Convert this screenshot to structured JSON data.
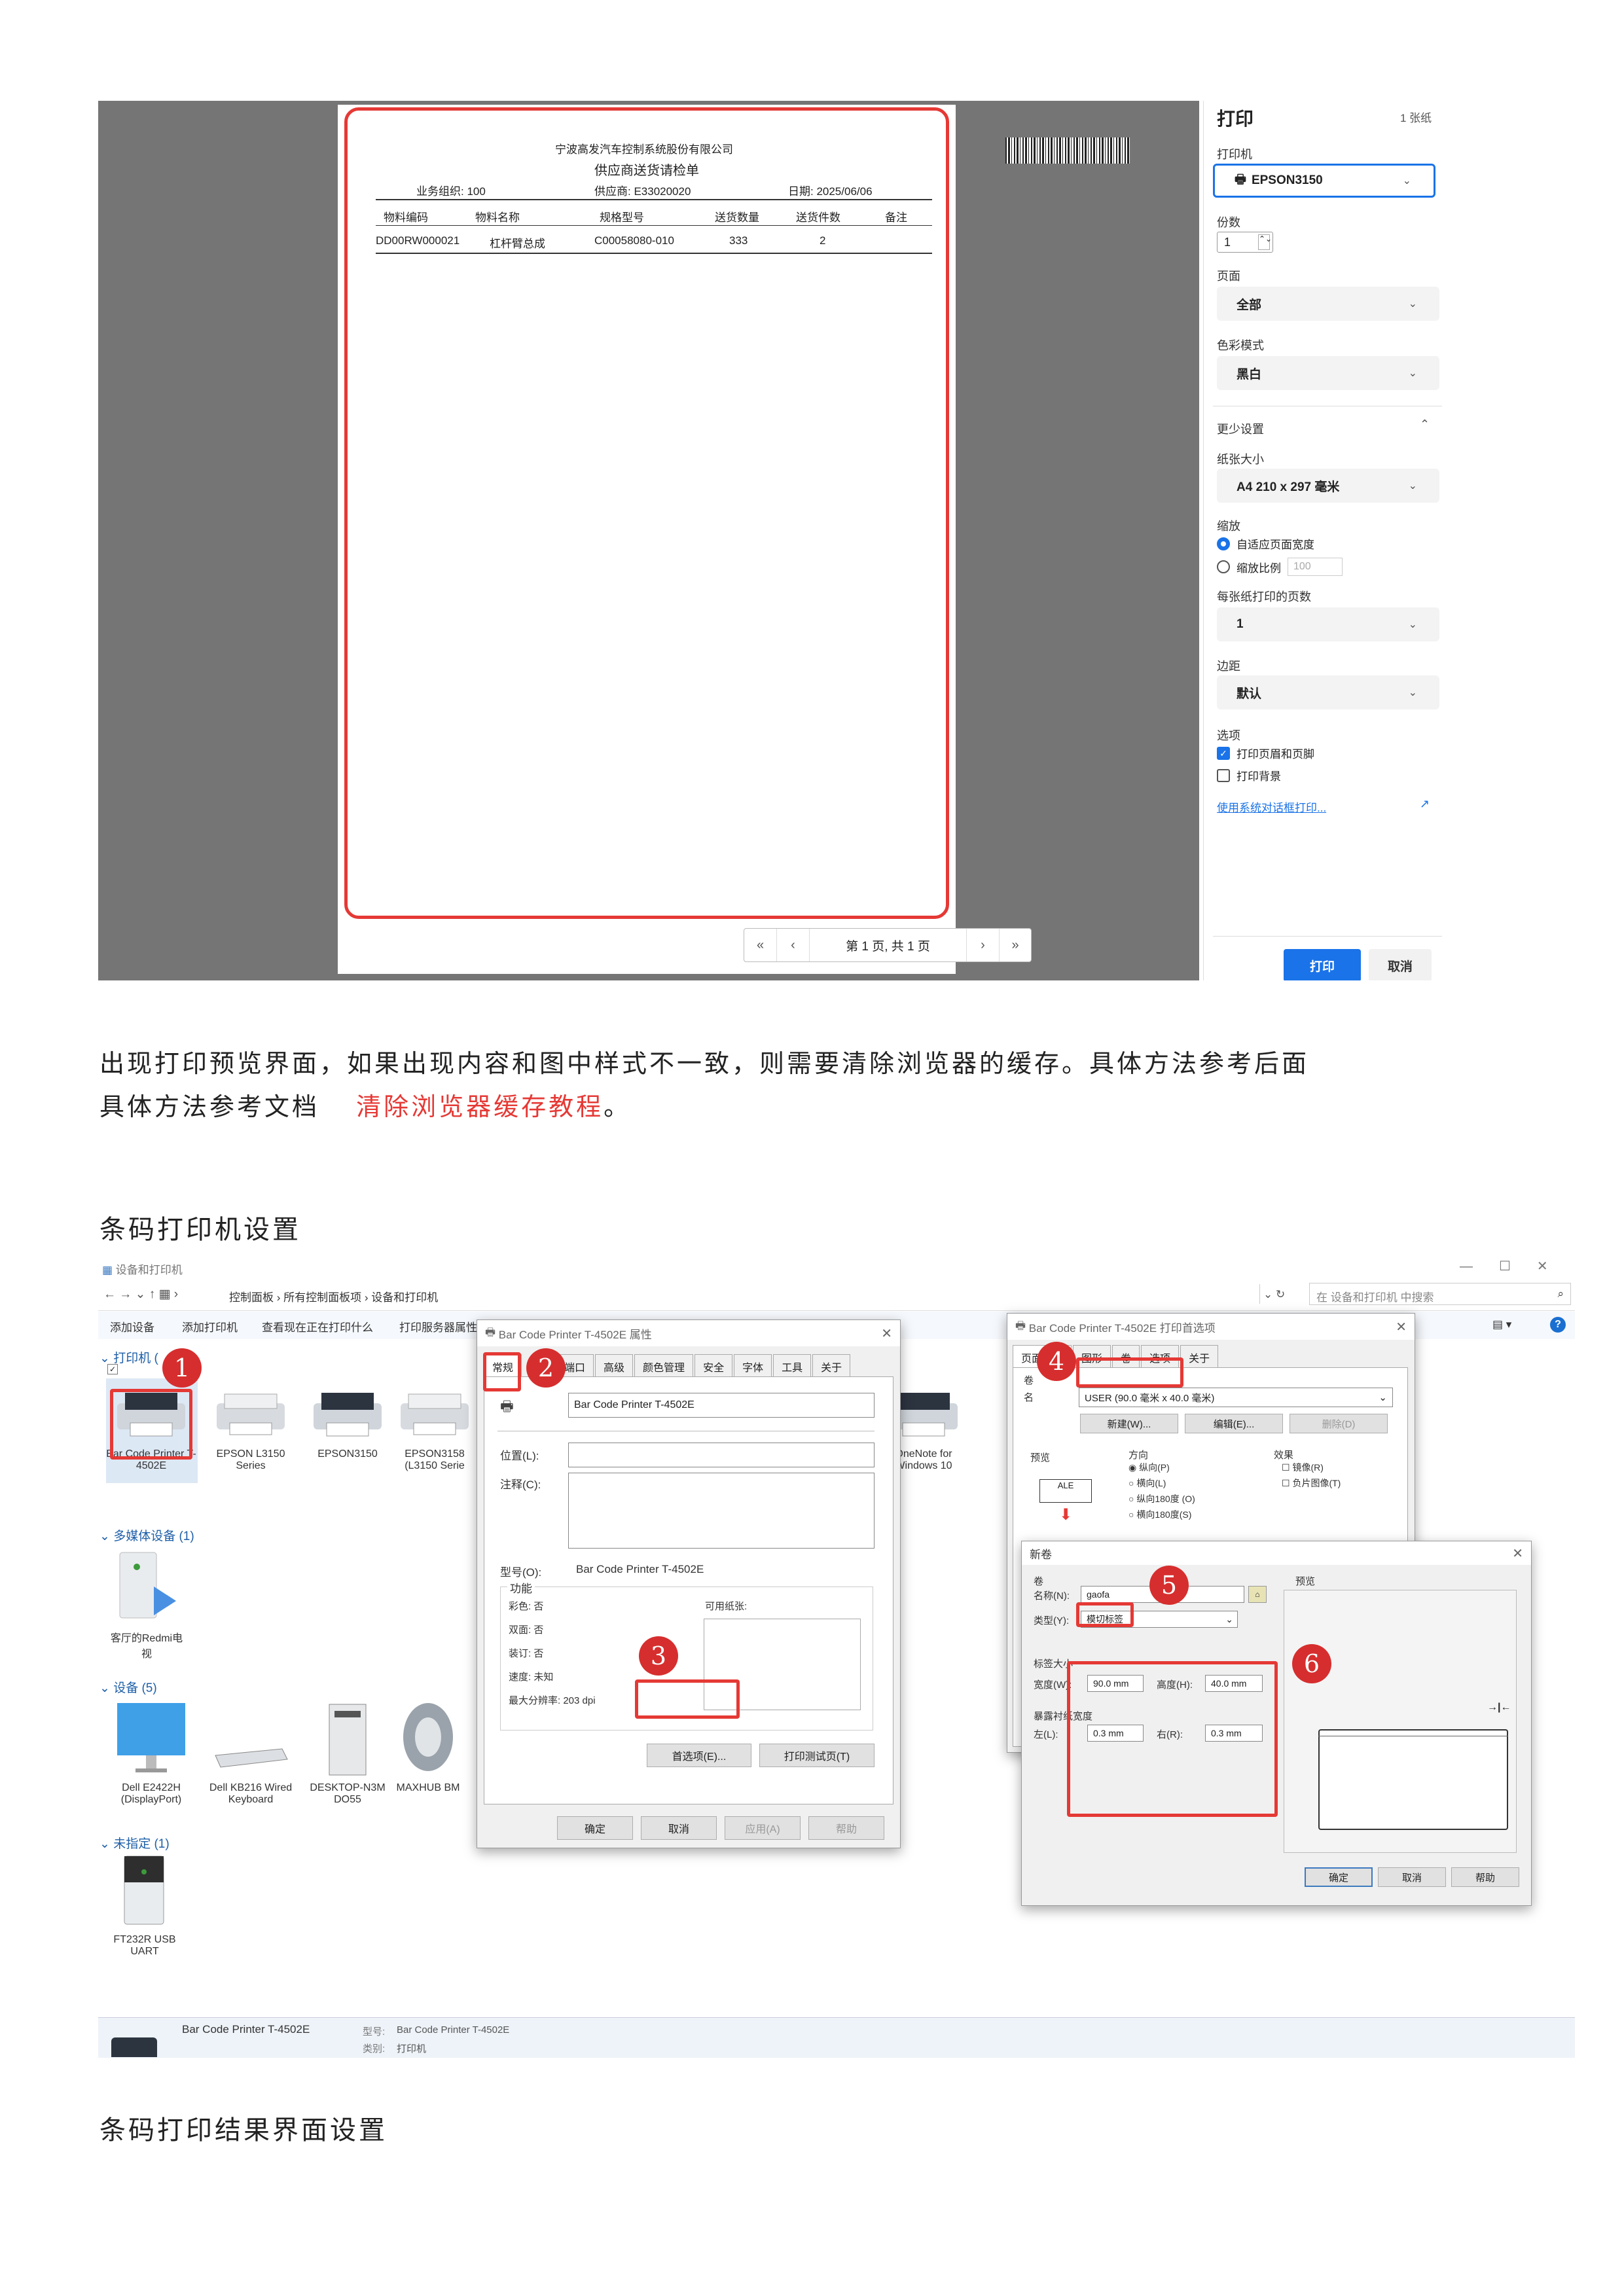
{
  "print_preview": {
    "company": "宁波高发汽车控制系统股份有限公司",
    "doc_title": "供应商送货请检单",
    "org_label": "业务组织: 100",
    "supplier_label": "供应商: E33020020",
    "date_label": "日期: 2025/06/06",
    "columns": [
      "物料编码",
      "物料名称",
      "规格型号",
      "送货数量",
      "送货件数",
      "备注"
    ],
    "row": [
      "DD00RW000021",
      "杠杆臂总成",
      "C00058080-010",
      "333",
      "2",
      ""
    ],
    "pager": {
      "first": "«",
      "prev": "‹",
      "page_text": "第 1 页, 共 1 页",
      "next": "›",
      "last": "»"
    }
  },
  "print_panel": {
    "title": "打印",
    "sheets": "1 张纸",
    "printer_label": "打印机",
    "printer_value": "EPSON3150",
    "copies_label": "份数",
    "copies_value": "1",
    "pages_label": "页面",
    "pages_value": "全部",
    "color_label": "色彩模式",
    "color_value": "黑白",
    "less_settings": "更少设置",
    "paper_label": "纸张大小",
    "paper_value": "A4 210 x 297 毫米",
    "scale_label": "缩放",
    "scale_fit": "自适应页面宽度",
    "scale_ratio": "缩放比例",
    "scale_ratio_value": "100",
    "pages_per_sheet_label": "每张纸打印的页数",
    "pages_per_sheet_value": "1",
    "margins_label": "边距",
    "margins_value": "默认",
    "options_label": "选项",
    "opt_header_footer": "打印页眉和页脚",
    "opt_background": "打印背景",
    "system_dialog_link": "使用系统对话框打印...",
    "print_button": "打印",
    "cancel_button": "取消"
  },
  "doc": {
    "line1": "出现打印预览界面，如果出现内容和图中样式不一致，则需要清除浏览器的缓存。具体方法参考后面",
    "line2_prefix": "具体方法参考文档",
    "line2_link": "清除浏览器缓存教程",
    "line2_suffix": "。",
    "heading1": "条码打印机设置",
    "heading2": "条码打印结果界面设置"
  },
  "devices_window": {
    "title": "设备和打印机",
    "breadcrumb": [
      "控制面板",
      "所有控制面板项",
      "设备和打印机"
    ],
    "search_placeholder": "在 设备和打印机 中搜索",
    "toolbar": [
      "添加设备",
      "添加打印机",
      "查看现在正在打印什么",
      "打印服务器属性"
    ],
    "group_printers": "打印机 (",
    "group_media": "多媒体设备 (1)",
    "group_devices": "设备 (5)",
    "group_unspecified": "未指定 (1)",
    "printers": [
      "Bar Code Printer T-4502E",
      "EPSON L3150 Series",
      "EPSON3150",
      "EPSON3158 (L3150 Serie",
      "OneNote for Windows 10"
    ],
    "media": [
      "客厅的Redmi电视"
    ],
    "devices": [
      "Dell E2422H (DisplayPort)",
      "Dell KB216 Wired Keyboard",
      "DESKTOP-N3M DO55",
      "MAXHUB BM"
    ],
    "unspecified": [
      "FT232R USB UART"
    ],
    "status_name": "Bar Code Printer T-4502E",
    "status_model_label": "型号:",
    "status_model": "Bar Code Printer T-4502E",
    "status_cat_label": "类别:",
    "status_cat": "打印机"
  },
  "props_dialog": {
    "title": "Bar Code Printer T-4502E 属性",
    "tabs": [
      "常规",
      "端口",
      "高级",
      "颜色管理",
      "安全",
      "字体",
      "工具",
      "关于"
    ],
    "name_value": "Bar Code Printer T-4502E",
    "location_label": "位置(L):",
    "comment_label": "注释(C):",
    "model_label": "型号(O):",
    "model_value": "Bar Code Printer T-4502E",
    "features_label": "功能",
    "color": "彩色: 否",
    "duplex": "双面: 否",
    "staple": "装订: 否",
    "speed": "速度: 未知",
    "dpi": "最大分辨率: 203 dpi",
    "paper_avail": "可用纸张:",
    "pref_button": "首选项(E)...",
    "test_button": "打印测试页(T)",
    "ok": "确定",
    "cancel": "取消",
    "apply": "应用(A)",
    "help": "帮助"
  },
  "prefs_dialog": {
    "title": "Bar Code Printer T-4502E 打印首选项",
    "tabs": [
      "页面设置",
      "图形",
      "卷",
      "选项",
      "关于"
    ],
    "stock_label": "卷",
    "name_prefix": "名",
    "stock_value": "USER (90.0 毫米 x 40.0 毫米)",
    "new_button": "新建(W)...",
    "edit_button": "编辑(E)...",
    "delete_button": "删除(D)",
    "preview_label": "预览",
    "preview_sample": "ALE",
    "orient_label": "方向",
    "orient": [
      "纵向(P)",
      "横向(L)",
      "纵向180度 (O)",
      "横向180度(S)"
    ],
    "effect_label": "效果",
    "effect": [
      "镜像(R)",
      "负片图像(T)"
    ]
  },
  "new_stock_dialog": {
    "title": "新卷",
    "stock_label": "卷",
    "name_label": "名称(N):",
    "name_value": "gaofa",
    "type_label": "类型(Y):",
    "type_value": "模切标签",
    "size_label": "标签大小",
    "width_label": "宽度(W):",
    "width_value": "90.0 mm",
    "height_label": "高度(H):",
    "height_value": "40.0 mm",
    "exposed_label": "暴露衬纸宽度",
    "left_label": "左(L):",
    "left_value": "0.3 mm",
    "right_label": "右(R):",
    "right_value": "0.3 mm",
    "preview_label": "预览",
    "ok": "确定",
    "cancel": "取消",
    "help": "帮助"
  },
  "step_numbers": [
    "1",
    "2",
    "3",
    "4",
    "5",
    "6"
  ],
  "colors": {
    "accent": "#1a73e8",
    "highlight_red": "#e53935",
    "step_red": "#d62e2e",
    "link_red": "#e53935"
  }
}
